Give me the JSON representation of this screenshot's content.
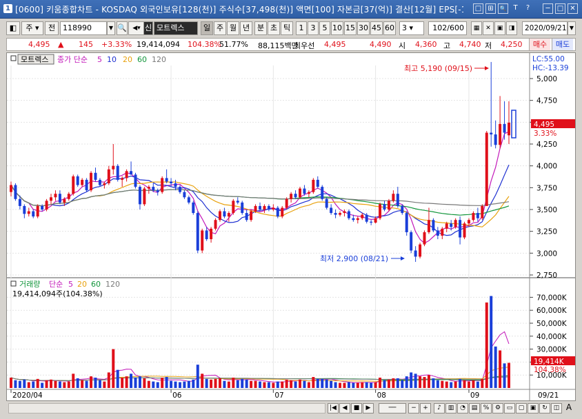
{
  "window": {
    "title": "[0600] 키움종합차트 - KOSDAQ 외국인보유[128(천)] 주식수[37,498(천)] 액면[100] 자본금[37(억)] 결산[12월] EPS[-1",
    "number_icon": "1",
    "buttons": [
      "□",
      "⊞",
      "🔍",
      "T",
      "?",
      "─",
      "□",
      "✕"
    ]
  },
  "toolbar": {
    "period_label": "주",
    "prev_label": "전",
    "code_value": "118990",
    "credit_label": "신",
    "stock_name": "모트렉스",
    "period_tabs": [
      "일",
      "주",
      "월",
      "년",
      "분",
      "초",
      "틱"
    ],
    "active_period": "일",
    "interval_buttons": [
      "1",
      "3",
      "5",
      "10",
      "15",
      "30",
      "45",
      "60"
    ],
    "interval_select": "3",
    "count_value": "102/600",
    "date_value": "2020/09/21"
  },
  "quote": {
    "price": "4,495",
    "arrow": "▲",
    "change": "145",
    "change_pct": "+3.33%",
    "volume": "19,414,094",
    "volume_ratio": "104.38%",
    "turnover": "51.77%",
    "amount": "88,115백만",
    "best_bid_label": "최우선",
    "ask": "4,495",
    "bid": "4,490",
    "open_label": "시",
    "open": "4,360",
    "high_label": "고",
    "high": "4,740",
    "low_label": "저",
    "low": "4,250",
    "buy_label": "매수",
    "sell_label": "매도"
  },
  "price_panel": {
    "stock_label": "모트렉스",
    "ma_title": "종가 단순",
    "ma_periods": [
      "5",
      "10",
      "20",
      "60",
      "120"
    ],
    "ma_colors": [
      "#c217b9",
      "#1d2fd1",
      "#e8a10c",
      "#11953a",
      "#787878"
    ],
    "lc": "LC:55.00",
    "hc": "HC:-13.39",
    "high_annotation": "최고 5,190 (09/15)",
    "low_annotation": "최저 2,900 (08/21)",
    "current_tag": "4,495",
    "current_pct": "3.33%",
    "y_ticks": [
      "5,000",
      "4,750",
      "4,500",
      "4,250",
      "4,000",
      "3,750",
      "3,500",
      "3,250",
      "3,000",
      "2,750"
    ]
  },
  "volume_panel": {
    "title": "거래량",
    "ma_title": "단순",
    "ma_periods": [
      "5",
      "20",
      "60",
      "120"
    ],
    "ma_colors": [
      "#c217b9",
      "#e8a10c",
      "#11953a",
      "#787878"
    ],
    "summary": "19,414,094주(104.38%)",
    "y_ticks": [
      "70,000K",
      "60,000K",
      "50,000K",
      "40,000K",
      "30,000K",
      "20,000K",
      "10,000K"
    ],
    "current_tag": "19,414K",
    "current_pct": "104.38%"
  },
  "x_axis": {
    "labels": [
      "2020/04",
      "06",
      "07",
      "08",
      "09"
    ],
    "end_label": "09/21"
  },
  "chart_data": {
    "type": "candlestick",
    "x_start": "2020/04",
    "x_end": "09/21",
    "ylim": [
      2750,
      5150
    ],
    "volume_ylim": [
      0,
      75000
    ],
    "volume_unit": "K",
    "colors": {
      "up": "#e0101a",
      "down": "#1a3fd9"
    },
    "candles": [
      [
        3700,
        3820,
        3650,
        3780,
        8000
      ],
      [
        3780,
        3800,
        3600,
        3620,
        6000
      ],
      [
        3620,
        3660,
        3500,
        3540,
        5500
      ],
      [
        3540,
        3560,
        3400,
        3450,
        6500
      ],
      [
        3450,
        3520,
        3420,
        3480,
        4500
      ],
      [
        3480,
        3500,
        3400,
        3420,
        5000
      ],
      [
        3420,
        3560,
        3400,
        3540,
        7000
      ],
      [
        3540,
        3560,
        3480,
        3500,
        4000
      ],
      [
        3500,
        3620,
        3480,
        3600,
        6000
      ],
      [
        3600,
        3680,
        3560,
        3640,
        6500
      ],
      [
        3640,
        3720,
        3600,
        3680,
        5500
      ],
      [
        3680,
        3720,
        3560,
        3580,
        5000
      ],
      [
        3580,
        3640,
        3540,
        3620,
        4500
      ],
      [
        3620,
        3700,
        3600,
        3680,
        5000
      ],
      [
        3680,
        3900,
        3660,
        3880,
        11000
      ],
      [
        3880,
        3900,
        3760,
        3780,
        7500
      ],
      [
        3780,
        3860,
        3760,
        3840,
        6000
      ],
      [
        3840,
        3860,
        3700,
        3720,
        5500
      ],
      [
        3720,
        3940,
        3700,
        3920,
        9000
      ],
      [
        3920,
        3980,
        3820,
        3840,
        8000
      ],
      [
        3840,
        3860,
        3760,
        3780,
        6000
      ],
      [
        3780,
        3820,
        3740,
        3800,
        5000
      ],
      [
        3800,
        4000,
        3780,
        3960,
        12000
      ],
      [
        3960,
        4250,
        3900,
        4000,
        30000
      ],
      [
        4000,
        4020,
        3820,
        3840,
        14000
      ],
      [
        3840,
        3880,
        3760,
        3860,
        8000
      ],
      [
        3860,
        3960,
        3820,
        3940,
        9000
      ],
      [
        3940,
        4050,
        3900,
        3900,
        11000
      ],
      [
        3900,
        3920,
        3740,
        3760,
        8000
      ],
      [
        3760,
        3780,
        3500,
        3560,
        9000
      ],
      [
        3560,
        3760,
        3540,
        3740,
        7500
      ],
      [
        3740,
        3780,
        3680,
        3760,
        5500
      ],
      [
        3760,
        3800,
        3700,
        3720,
        5000
      ],
      [
        3720,
        3740,
        3660,
        3700,
        4500
      ],
      [
        3700,
        3880,
        3680,
        3860,
        8000
      ],
      [
        3860,
        3960,
        3800,
        3820,
        8500
      ],
      [
        3820,
        3860,
        3760,
        3800,
        5500
      ],
      [
        3800,
        3840,
        3720,
        3760,
        5000
      ],
      [
        3760,
        3780,
        3680,
        3700,
        4500
      ],
      [
        3700,
        3720,
        3620,
        3640,
        5000
      ],
      [
        3640,
        3660,
        3560,
        3580,
        5500
      ],
      [
        3580,
        3600,
        3440,
        3460,
        6500
      ],
      [
        3460,
        3480,
        3000,
        3030,
        18000
      ],
      [
        3030,
        3280,
        3000,
        3260,
        11000
      ],
      [
        3260,
        3300,
        3140,
        3160,
        7000
      ],
      [
        3160,
        3300,
        3120,
        3280,
        6500
      ],
      [
        3280,
        3400,
        3260,
        3380,
        7000
      ],
      [
        3380,
        3500,
        3360,
        3480,
        7500
      ],
      [
        3480,
        3520,
        3400,
        3420,
        5500
      ],
      [
        3420,
        3480,
        3360,
        3460,
        5000
      ],
      [
        3460,
        3620,
        3440,
        3600,
        8000
      ],
      [
        3600,
        3640,
        3560,
        3580,
        6000
      ],
      [
        3580,
        3600,
        3440,
        3460,
        7000
      ],
      [
        3460,
        3500,
        3360,
        3380,
        6500
      ],
      [
        3380,
        3500,
        3360,
        3480,
        5500
      ],
      [
        3480,
        3560,
        3460,
        3540,
        5500
      ],
      [
        3540,
        3580,
        3480,
        3500,
        5000
      ],
      [
        3500,
        3560,
        3460,
        3540,
        4500
      ],
      [
        3540,
        3560,
        3480,
        3500,
        4500
      ],
      [
        3500,
        3560,
        3480,
        3520,
        4000
      ],
      [
        3520,
        3540,
        3400,
        3420,
        5000
      ],
      [
        3420,
        3540,
        3400,
        3520,
        5000
      ],
      [
        3520,
        3640,
        3500,
        3620,
        6500
      ],
      [
        3620,
        3700,
        3580,
        3680,
        6000
      ],
      [
        3680,
        3720,
        3620,
        3640,
        5000
      ],
      [
        3640,
        3760,
        3620,
        3740,
        6500
      ],
      [
        3740,
        3780,
        3660,
        3680,
        5500
      ],
      [
        3680,
        3720,
        3640,
        3700,
        4500
      ],
      [
        3700,
        3860,
        3680,
        3840,
        8500
      ],
      [
        3840,
        3880,
        3740,
        3760,
        7000
      ],
      [
        3760,
        3780,
        3600,
        3620,
        7000
      ],
      [
        3620,
        3640,
        3500,
        3520,
        6500
      ],
      [
        3520,
        3560,
        3440,
        3460,
        5500
      ],
      [
        3460,
        3500,
        3400,
        3440,
        4500
      ],
      [
        3440,
        3480,
        3420,
        3460,
        4000
      ],
      [
        3460,
        3500,
        3420,
        3480,
        4000
      ],
      [
        3480,
        3500,
        3380,
        3400,
        4500
      ],
      [
        3400,
        3440,
        3360,
        3380,
        4000
      ],
      [
        3380,
        3420,
        3340,
        3400,
        4000
      ],
      [
        3400,
        3460,
        3380,
        3440,
        4500
      ],
      [
        3440,
        3460,
        3340,
        3360,
        4500
      ],
      [
        3360,
        3380,
        3320,
        3350,
        4000
      ],
      [
        3350,
        3420,
        3340,
        3400,
        4500
      ],
      [
        3400,
        3580,
        3380,
        3560,
        8000
      ],
      [
        3560,
        3600,
        3480,
        3500,
        6000
      ],
      [
        3500,
        3620,
        3480,
        3600,
        6500
      ],
      [
        3600,
        3720,
        3580,
        3680,
        7500
      ],
      [
        3680,
        3760,
        3520,
        3540,
        7500
      ],
      [
        3540,
        3560,
        3440,
        3460,
        6000
      ],
      [
        3460,
        3480,
        3200,
        3240,
        9000
      ],
      [
        3240,
        3260,
        3000,
        3030,
        12000
      ],
      [
        3030,
        3080,
        2900,
        2960,
        11000
      ],
      [
        2960,
        3120,
        2940,
        3100,
        9000
      ],
      [
        3100,
        3260,
        3080,
        3240,
        8500
      ],
      [
        3240,
        3520,
        3220,
        3380,
        10000
      ],
      [
        3380,
        3400,
        3240,
        3260,
        7500
      ],
      [
        3260,
        3300,
        3160,
        3200,
        6000
      ],
      [
        3200,
        3300,
        3160,
        3280,
        5500
      ],
      [
        3280,
        3360,
        3240,
        3340,
        5000
      ],
      [
        3340,
        3380,
        3260,
        3300,
        4500
      ],
      [
        3300,
        3400,
        3280,
        3380,
        5000
      ],
      [
        3380,
        3420,
        3100,
        3180,
        7000
      ],
      [
        3180,
        3360,
        3160,
        3340,
        6000
      ],
      [
        3340,
        3400,
        3300,
        3380,
        5000
      ],
      [
        3380,
        3480,
        3360,
        3460,
        6000
      ],
      [
        3460,
        3520,
        3360,
        3400,
        5000
      ],
      [
        3400,
        3560,
        3380,
        3540,
        7000
      ],
      [
        3540,
        4400,
        3540,
        4380,
        66000
      ],
      [
        4380,
        5190,
        4220,
        4360,
        71000
      ],
      [
        4360,
        4520,
        4200,
        4240,
        32000
      ],
      [
        4240,
        4800,
        4200,
        4480,
        29000
      ],
      [
        4480,
        4740,
        4300,
        4380,
        19000
      ],
      [
        4350,
        4740,
        4250,
        4495,
        19414
      ]
    ]
  }
}
